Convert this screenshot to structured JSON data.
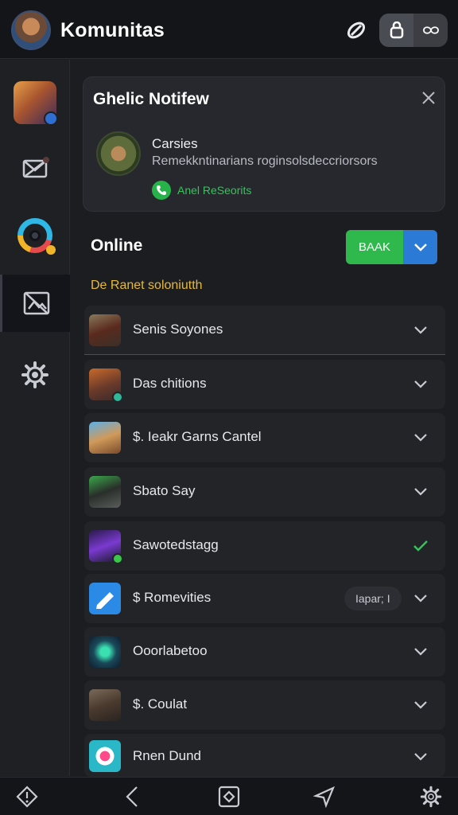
{
  "header": {
    "title": "Komunitas",
    "icons": [
      "avatar",
      "link-icon",
      "lock-icon",
      "infinity-icon"
    ]
  },
  "sidebar": {
    "items": [
      {
        "name": "game-thumb"
      },
      {
        "name": "mail-icon"
      },
      {
        "name": "ring-icon"
      },
      {
        "name": "image-off-icon",
        "active": true
      },
      {
        "name": "gear-icon"
      }
    ]
  },
  "notification": {
    "title": "Ghelic Notifew",
    "name": "Carsies",
    "description": "Remekkntinarians roginsolsdeccriorsors",
    "status": "Anel ReSeorits"
  },
  "online": {
    "label": "Online",
    "button_label": "BAAK",
    "subheading": "De Ranet soloniutth"
  },
  "list": {
    "items": [
      {
        "label": "Senis Soyones",
        "check": "chevron"
      },
      {
        "label": "Das chitions",
        "check": "chevron"
      },
      {
        "label": "$. Ieakr Garns Cantel",
        "check": "chevron"
      },
      {
        "label": "Sbato Say",
        "check": "chevron"
      },
      {
        "label": "Sawotedstagg",
        "check": "check"
      },
      {
        "label": "$ Romevities",
        "tag": "Iapar; I",
        "check": "chevron"
      },
      {
        "label": "Ooorlabetoo",
        "check": "chevron"
      },
      {
        "label": "$. Coulat",
        "check": "chevron"
      },
      {
        "label": "Rnen Dund",
        "check": "chevron"
      }
    ]
  },
  "colors": {
    "background": "#1b1d21",
    "accent_green": "#2fb84c",
    "accent_blue": "#2a7ad6",
    "subheading_yellow": "#e6b93a"
  }
}
